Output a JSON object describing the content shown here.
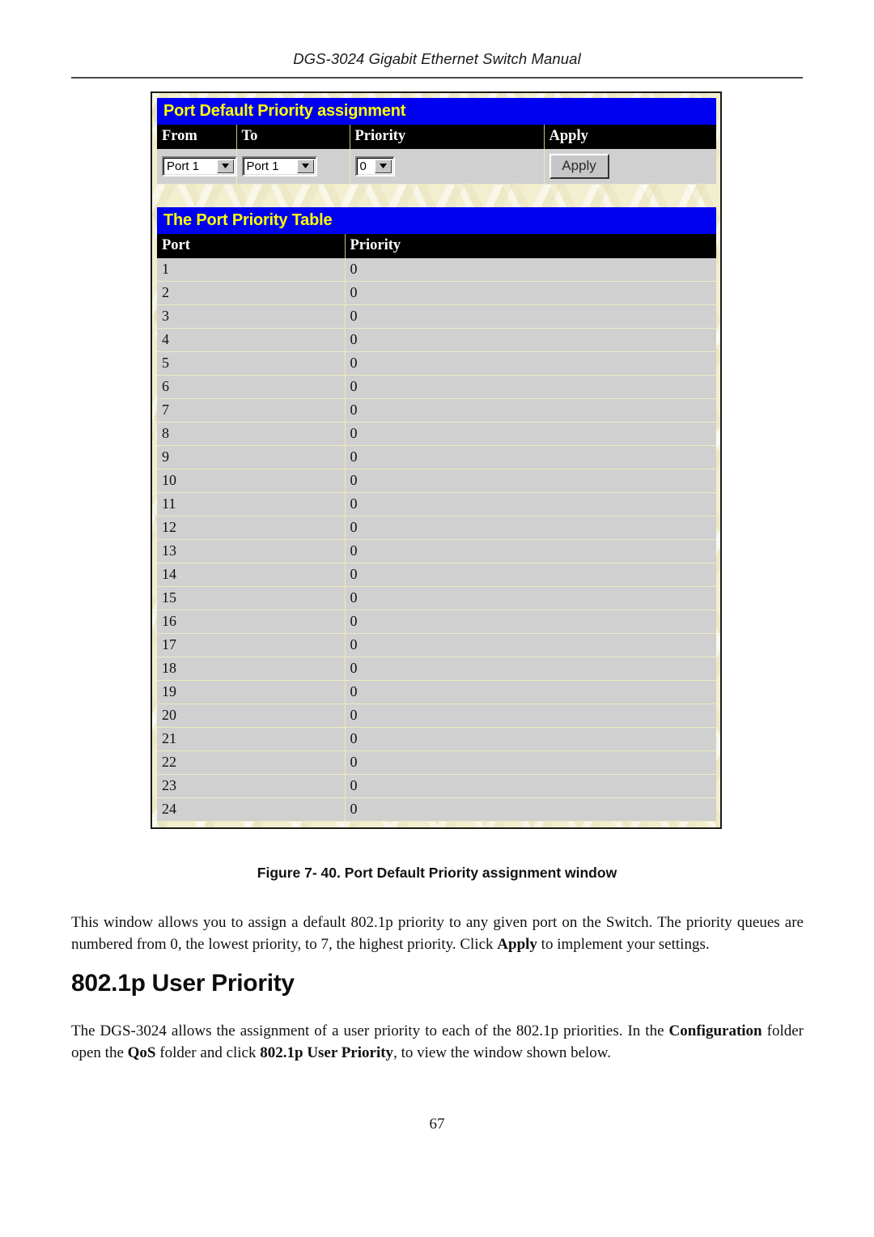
{
  "header": {
    "running_title": "DGS-3024 Gigabit Ethernet Switch Manual"
  },
  "screenshot": {
    "assignment_panel": {
      "title": "Port Default Priority assignment",
      "columns": [
        "From",
        "To",
        "Priority",
        "Apply"
      ],
      "from_value": "Port 1",
      "to_value": "Port 1",
      "priority_value": "0",
      "apply_label": "Apply"
    },
    "priority_table": {
      "title": "The Port Priority Table",
      "columns": [
        "Port",
        "Priority"
      ],
      "rows": [
        {
          "port": "1",
          "priority": "0"
        },
        {
          "port": "2",
          "priority": "0"
        },
        {
          "port": "3",
          "priority": "0"
        },
        {
          "port": "4",
          "priority": "0"
        },
        {
          "port": "5",
          "priority": "0"
        },
        {
          "port": "6",
          "priority": "0"
        },
        {
          "port": "7",
          "priority": "0"
        },
        {
          "port": "8",
          "priority": "0"
        },
        {
          "port": "9",
          "priority": "0"
        },
        {
          "port": "10",
          "priority": "0"
        },
        {
          "port": "11",
          "priority": "0"
        },
        {
          "port": "12",
          "priority": "0"
        },
        {
          "port": "13",
          "priority": "0"
        },
        {
          "port": "14",
          "priority": "0"
        },
        {
          "port": "15",
          "priority": "0"
        },
        {
          "port": "16",
          "priority": "0"
        },
        {
          "port": "17",
          "priority": "0"
        },
        {
          "port": "18",
          "priority": "0"
        },
        {
          "port": "19",
          "priority": "0"
        },
        {
          "port": "20",
          "priority": "0"
        },
        {
          "port": "21",
          "priority": "0"
        },
        {
          "port": "22",
          "priority": "0"
        },
        {
          "port": "23",
          "priority": "0"
        },
        {
          "port": "24",
          "priority": "0"
        }
      ]
    }
  },
  "figure_caption": "Figure 7- 40. Port Default Priority assignment window",
  "paragraph_1": {
    "part_1": "This window allows you to assign a default 802.1p priority to any given port on the Switch. The priority queues are numbered from 0, the lowest priority, to 7, the highest priority. Click ",
    "bold_1": "Apply",
    "part_2": " to implement your settings."
  },
  "section_heading": "802.1p User Priority",
  "paragraph_2": {
    "part_1": "The DGS-3024 allows the assignment of a user priority to each of the 802.1p priorities. In the ",
    "bold_1": "Configuration",
    "part_2": " folder open the ",
    "bold_2": "QoS",
    "part_3": " folder and click ",
    "bold_3": "802.1p User Priority",
    "part_4": ", to view the window shown below."
  },
  "page_number": "67",
  "colors": {
    "panel_title_bg": "#0000f0",
    "panel_title_text": "#ffff00",
    "column_header_bg": "#000000",
    "row_bg": "#d0d0d0",
    "shot_bg": "#f2eed0"
  }
}
